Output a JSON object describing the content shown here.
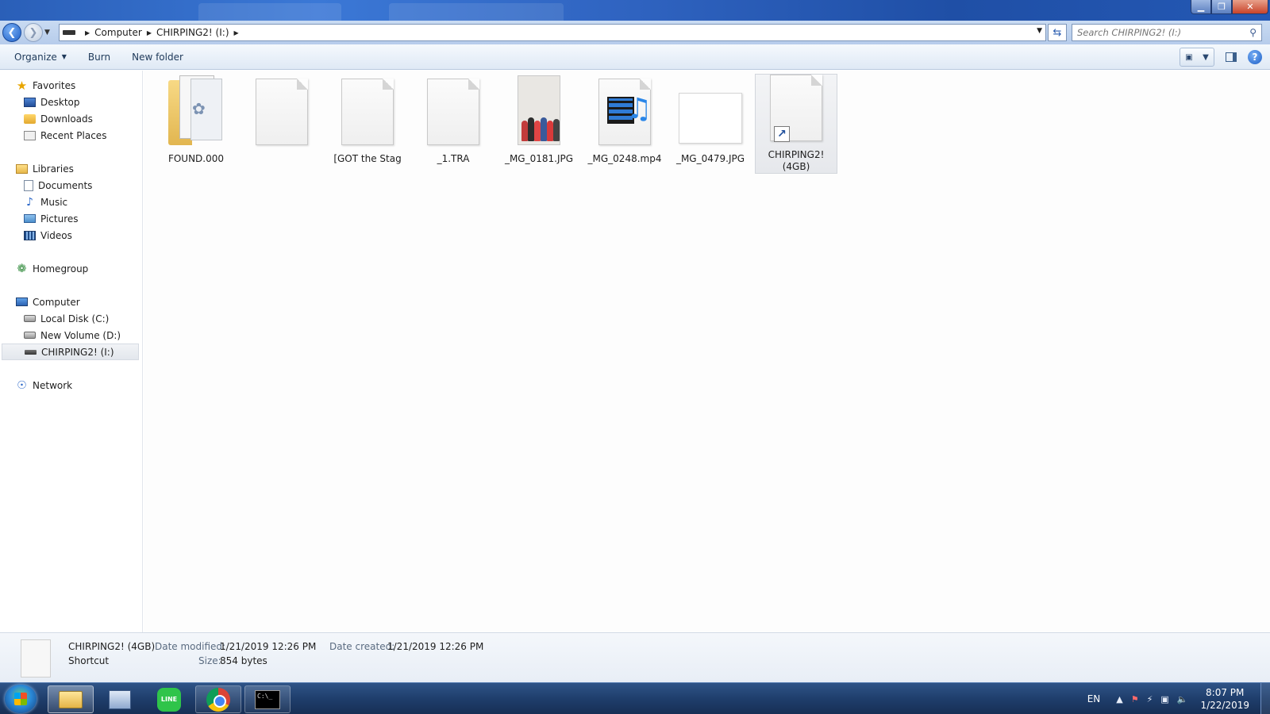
{
  "window": {
    "controls": {
      "minimize": "▁",
      "maximize": "❐",
      "close": "✕"
    }
  },
  "navbar": {
    "breadcrumbs": [
      "Computer",
      "CHIRPING2! (I:)"
    ],
    "search_placeholder": "Search CHIRPING2! (I:)"
  },
  "toolbar": {
    "organize": "Organize",
    "burn": "Burn",
    "new_folder": "New folder"
  },
  "sidebar": {
    "favorites": {
      "label": "Favorites",
      "items": [
        "Desktop",
        "Downloads",
        "Recent Places"
      ]
    },
    "libraries": {
      "label": "Libraries",
      "items": [
        "Documents",
        "Music",
        "Pictures",
        "Videos"
      ]
    },
    "homegroup": "Homegroup",
    "computer": {
      "label": "Computer",
      "items": [
        "Local Disk (C:)",
        "New Volume (D:)",
        "CHIRPING2! (I:)"
      ]
    },
    "network": "Network",
    "selected": "CHIRPING2! (I:)"
  },
  "files": [
    {
      "name": "FOUND.000",
      "kind": "folder"
    },
    {
      "name": "",
      "kind": "blank"
    },
    {
      "name": "[GOT the Stag",
      "kind": "blank"
    },
    {
      "name": "_1.TRA",
      "kind": "blank"
    },
    {
      "name": "_MG_0181.JPG",
      "kind": "photo"
    },
    {
      "name": "_MG_0248.mp4",
      "kind": "video"
    },
    {
      "name": "_MG_0479.JPG",
      "kind": "white-image"
    },
    {
      "name": "CHIRPING2! (4GB)",
      "kind": "shortcut",
      "selected": true
    }
  ],
  "details": {
    "name": "CHIRPING2! (4GB)",
    "type": "Shortcut",
    "date_modified_label": "Date modified:",
    "date_modified": "1/21/2019 12:26 PM",
    "date_created_label": "Date created:",
    "date_created": "1/21/2019 12:26 PM",
    "size_label": "Size:",
    "size": "854 bytes"
  },
  "taskbar": {
    "apps": [
      "windows-explorer",
      "computer",
      "line",
      "chrome",
      "command-prompt"
    ],
    "line_label": "LINE",
    "cmd_label": "C:\\_",
    "language": "EN",
    "time": "8:07 PM",
    "date": "1/22/2019"
  },
  "colors": {
    "titlebar": "#2f63c0",
    "taskbar": "#1f3e6c",
    "selection": "#e6e8ec"
  }
}
